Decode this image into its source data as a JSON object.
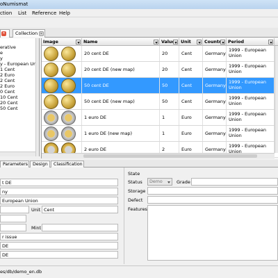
{
  "window": {
    "title": "oNumismat"
  },
  "menu": [
    {
      "label": "ction"
    },
    {
      "label": "List"
    },
    {
      "label": "Reference"
    },
    {
      "label": "Help"
    }
  ],
  "doc_tabs": [
    {
      "label": ""
    },
    {
      "label": "Collection"
    }
  ],
  "tree": {
    "items": [
      "erative",
      "e",
      "y",
      "y - European Union",
      "1 Cent",
      "2 Euro",
      "2 Cent",
      "2 Euro",
      "0 Cent",
      "10 Cent",
      "20 Cent",
      "50 Cent"
    ]
  },
  "table": {
    "columns": [
      "Image",
      "Name",
      "Value",
      "Unit",
      "Country",
      "Period"
    ],
    "rows": [
      {
        "name": "20 cent DE",
        "value": "20",
        "unit": "Cent",
        "country": "Germany",
        "period": "1999 - European Union",
        "coin": "gold",
        "selected": false
      },
      {
        "name": "20 cent DE (new map)",
        "value": "20",
        "unit": "Cent",
        "country": "Germany",
        "period": "1999 - European Union",
        "coin": "gold",
        "selected": false
      },
      {
        "name": "50 cent DE",
        "value": "50",
        "unit": "Cent",
        "country": "Germany",
        "period": "1999 - European Union",
        "coin": "gold",
        "selected": true
      },
      {
        "name": "50 cent DE (new map)",
        "value": "50",
        "unit": "Cent",
        "country": "Germany",
        "period": "1999 - European Union",
        "coin": "gold",
        "selected": false
      },
      {
        "name": "1 euro DE",
        "value": "1",
        "unit": "Euro",
        "country": "Germany",
        "period": "1999 - European Union",
        "coin": "bi",
        "selected": false
      },
      {
        "name": "1 euro DE (new map)",
        "value": "1",
        "unit": "Euro",
        "country": "Germany",
        "period": "1999 - European Union",
        "coin": "bi",
        "selected": false
      },
      {
        "name": "2 euro DE",
        "value": "2",
        "unit": "Euro",
        "country": "Germany",
        "period": "1999 - European Union",
        "coin": "bi2",
        "selected": false
      }
    ]
  },
  "panel_tabs": [
    "Parameters",
    "Design",
    "Classification"
  ],
  "details": {
    "main": {
      "title_value": "t DE",
      "country_value": "ny",
      "period_value": "European Union",
      "unit_label": "Unit",
      "unit_value": "Cent",
      "mint_label": "Mint",
      "issue_value": "r issue",
      "de_value_1": "DE",
      "de_value_2": "DE"
    },
    "state": {
      "section_label": "State",
      "status_label": "Status",
      "status_value": "Demo",
      "grade_label": "Grade",
      "storage_label": "Storage",
      "defect_label": "Defect",
      "features_label": "Features"
    }
  },
  "status": {
    "path": "es/db/demo_en.db"
  }
}
